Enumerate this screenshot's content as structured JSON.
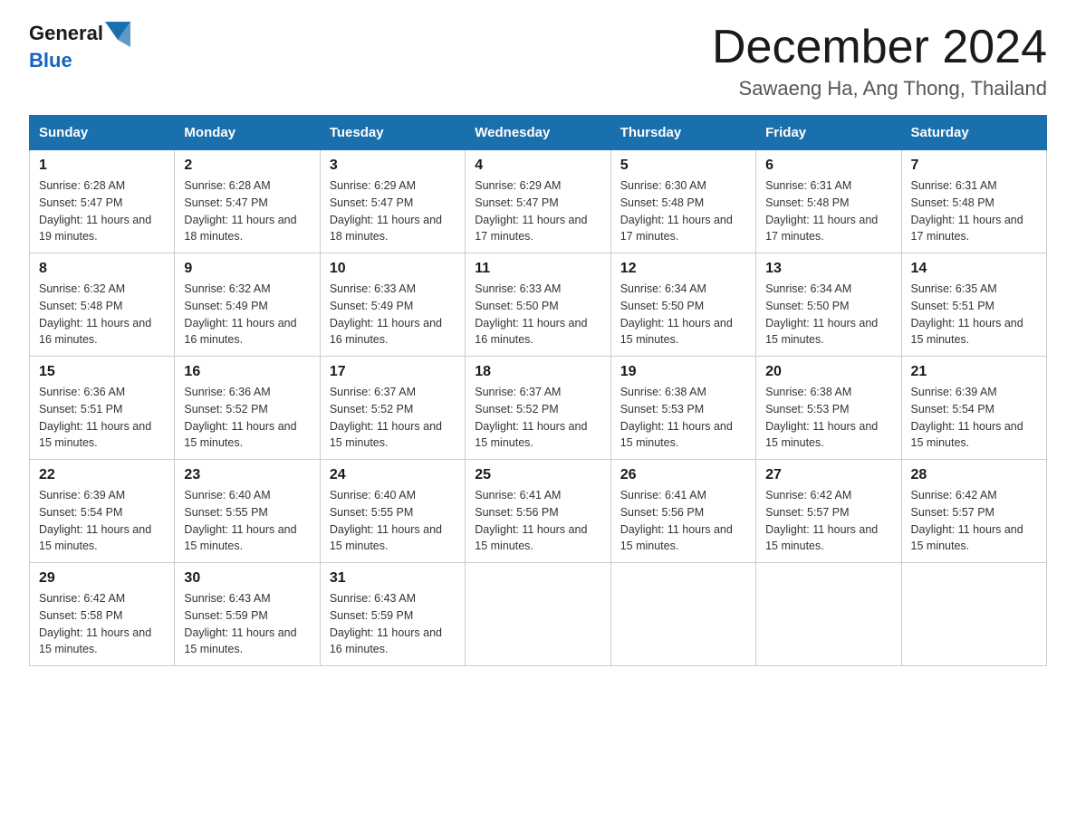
{
  "header": {
    "logo_general": "General",
    "logo_blue": "Blue",
    "month_title": "December 2024",
    "location": "Sawaeng Ha, Ang Thong, Thailand"
  },
  "weekdays": [
    "Sunday",
    "Monday",
    "Tuesday",
    "Wednesday",
    "Thursday",
    "Friday",
    "Saturday"
  ],
  "weeks": [
    [
      {
        "day": "1",
        "sunrise": "6:28 AM",
        "sunset": "5:47 PM",
        "daylight": "11 hours and 19 minutes."
      },
      {
        "day": "2",
        "sunrise": "6:28 AM",
        "sunset": "5:47 PM",
        "daylight": "11 hours and 18 minutes."
      },
      {
        "day": "3",
        "sunrise": "6:29 AM",
        "sunset": "5:47 PM",
        "daylight": "11 hours and 18 minutes."
      },
      {
        "day": "4",
        "sunrise": "6:29 AM",
        "sunset": "5:47 PM",
        "daylight": "11 hours and 17 minutes."
      },
      {
        "day": "5",
        "sunrise": "6:30 AM",
        "sunset": "5:48 PM",
        "daylight": "11 hours and 17 minutes."
      },
      {
        "day": "6",
        "sunrise": "6:31 AM",
        "sunset": "5:48 PM",
        "daylight": "11 hours and 17 minutes."
      },
      {
        "day": "7",
        "sunrise": "6:31 AM",
        "sunset": "5:48 PM",
        "daylight": "11 hours and 17 minutes."
      }
    ],
    [
      {
        "day": "8",
        "sunrise": "6:32 AM",
        "sunset": "5:48 PM",
        "daylight": "11 hours and 16 minutes."
      },
      {
        "day": "9",
        "sunrise": "6:32 AM",
        "sunset": "5:49 PM",
        "daylight": "11 hours and 16 minutes."
      },
      {
        "day": "10",
        "sunrise": "6:33 AM",
        "sunset": "5:49 PM",
        "daylight": "11 hours and 16 minutes."
      },
      {
        "day": "11",
        "sunrise": "6:33 AM",
        "sunset": "5:50 PM",
        "daylight": "11 hours and 16 minutes."
      },
      {
        "day": "12",
        "sunrise": "6:34 AM",
        "sunset": "5:50 PM",
        "daylight": "11 hours and 15 minutes."
      },
      {
        "day": "13",
        "sunrise": "6:34 AM",
        "sunset": "5:50 PM",
        "daylight": "11 hours and 15 minutes."
      },
      {
        "day": "14",
        "sunrise": "6:35 AM",
        "sunset": "5:51 PM",
        "daylight": "11 hours and 15 minutes."
      }
    ],
    [
      {
        "day": "15",
        "sunrise": "6:36 AM",
        "sunset": "5:51 PM",
        "daylight": "11 hours and 15 minutes."
      },
      {
        "day": "16",
        "sunrise": "6:36 AM",
        "sunset": "5:52 PM",
        "daylight": "11 hours and 15 minutes."
      },
      {
        "day": "17",
        "sunrise": "6:37 AM",
        "sunset": "5:52 PM",
        "daylight": "11 hours and 15 minutes."
      },
      {
        "day": "18",
        "sunrise": "6:37 AM",
        "sunset": "5:52 PM",
        "daylight": "11 hours and 15 minutes."
      },
      {
        "day": "19",
        "sunrise": "6:38 AM",
        "sunset": "5:53 PM",
        "daylight": "11 hours and 15 minutes."
      },
      {
        "day": "20",
        "sunrise": "6:38 AM",
        "sunset": "5:53 PM",
        "daylight": "11 hours and 15 minutes."
      },
      {
        "day": "21",
        "sunrise": "6:39 AM",
        "sunset": "5:54 PM",
        "daylight": "11 hours and 15 minutes."
      }
    ],
    [
      {
        "day": "22",
        "sunrise": "6:39 AM",
        "sunset": "5:54 PM",
        "daylight": "11 hours and 15 minutes."
      },
      {
        "day": "23",
        "sunrise": "6:40 AM",
        "sunset": "5:55 PM",
        "daylight": "11 hours and 15 minutes."
      },
      {
        "day": "24",
        "sunrise": "6:40 AM",
        "sunset": "5:55 PM",
        "daylight": "11 hours and 15 minutes."
      },
      {
        "day": "25",
        "sunrise": "6:41 AM",
        "sunset": "5:56 PM",
        "daylight": "11 hours and 15 minutes."
      },
      {
        "day": "26",
        "sunrise": "6:41 AM",
        "sunset": "5:56 PM",
        "daylight": "11 hours and 15 minutes."
      },
      {
        "day": "27",
        "sunrise": "6:42 AM",
        "sunset": "5:57 PM",
        "daylight": "11 hours and 15 minutes."
      },
      {
        "day": "28",
        "sunrise": "6:42 AM",
        "sunset": "5:57 PM",
        "daylight": "11 hours and 15 minutes."
      }
    ],
    [
      {
        "day": "29",
        "sunrise": "6:42 AM",
        "sunset": "5:58 PM",
        "daylight": "11 hours and 15 minutes."
      },
      {
        "day": "30",
        "sunrise": "6:43 AM",
        "sunset": "5:59 PM",
        "daylight": "11 hours and 15 minutes."
      },
      {
        "day": "31",
        "sunrise": "6:43 AM",
        "sunset": "5:59 PM",
        "daylight": "11 hours and 16 minutes."
      },
      null,
      null,
      null,
      null
    ]
  ]
}
